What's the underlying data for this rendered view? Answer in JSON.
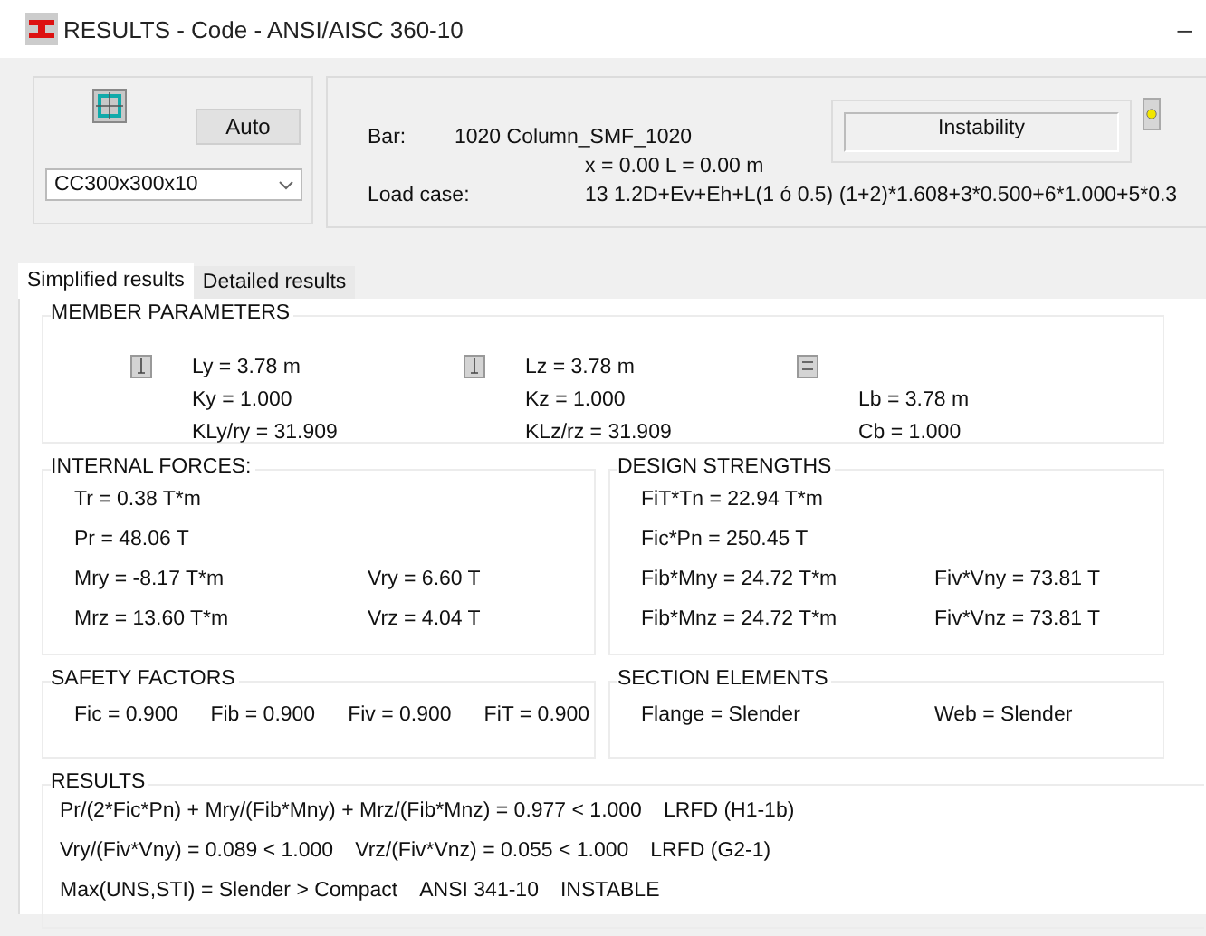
{
  "window": {
    "title": "RESULTS - Code - ANSI/AISC 360-10",
    "minimize": "–"
  },
  "section_panel": {
    "auto_button": "Auto",
    "section_dropdown": "CC300x300x10"
  },
  "bar_panel": {
    "bar_label": "Bar:",
    "bar_value": "1020  Column_SMF_1020",
    "position": "x = 0.00 L = 0.00 m",
    "load_label": "Load case:",
    "load_value": "13 1.2D+Ev+Eh+L(1 ó 0.5)  (1+2)*1.608+3*0.500+6*1.000+5*0.3",
    "status": "Instability",
    "indicator_on": true
  },
  "tabs": [
    {
      "label": "Simplified results",
      "selected": true
    },
    {
      "label": "Detailed results",
      "selected": false
    }
  ],
  "member_parameters": {
    "title": "MEMBER PARAMETERS",
    "groups": [
      {
        "lines": [
          "Ly = 3.78 m",
          "Ky = 1.000",
          "KLy/ry = 31.909"
        ]
      },
      {
        "lines": [
          "Lz = 3.78 m",
          "Kz = 1.000",
          "KLz/rz = 31.909"
        ]
      },
      {
        "lines": [
          "Lb = 3.78 m",
          "Cb = 1.000"
        ]
      }
    ]
  },
  "internal_forces": {
    "title": "INTERNAL FORCES:",
    "rows": [
      [
        "Tr = 0.38 T*m"
      ],
      [
        "Pr = 48.06 T"
      ],
      [
        "Mry = -8.17 T*m",
        "Vry = 6.60 T"
      ],
      [
        "Mrz = 13.60 T*m",
        "Vrz = 4.04 T"
      ]
    ]
  },
  "design_strengths": {
    "title": "DESIGN STRENGTHS",
    "rows": [
      [
        "FiT*Tn = 22.94 T*m"
      ],
      [
        "Fic*Pn = 250.45 T"
      ],
      [
        "Fib*Mny = 24.72 T*m",
        "Fiv*Vny = 73.81 T"
      ],
      [
        "Fib*Mnz = 24.72 T*m",
        "Fiv*Vnz = 73.81 T"
      ]
    ]
  },
  "safety_factors": {
    "title": "SAFETY FACTORS",
    "items": [
      "Fic = 0.900",
      "Fib = 0.900",
      "Fiv = 0.900",
      "FiT = 0.900"
    ]
  },
  "section_elements": {
    "title": "SECTION ELEMENTS",
    "items": [
      "Flange = Slender",
      "Web = Slender"
    ]
  },
  "results": {
    "title": "RESULTS",
    "lines": [
      [
        "Pr/(2*Fic*Pn) + Mry/(Fib*Mny) + Mrz/(Fib*Mnz) = 0.977 < 1.000",
        "LRFD (H1-1b)"
      ],
      [
        "Vry/(Fiv*Vny) = 0.089 < 1.000",
        "Vrz/(Fiv*Vnz) = 0.055 < 1.000",
        "LRFD (G2-1)"
      ],
      [
        "Max(UNS,STI) = Slender > Compact",
        "ANSI 341-10",
        "INSTABLE"
      ]
    ]
  }
}
